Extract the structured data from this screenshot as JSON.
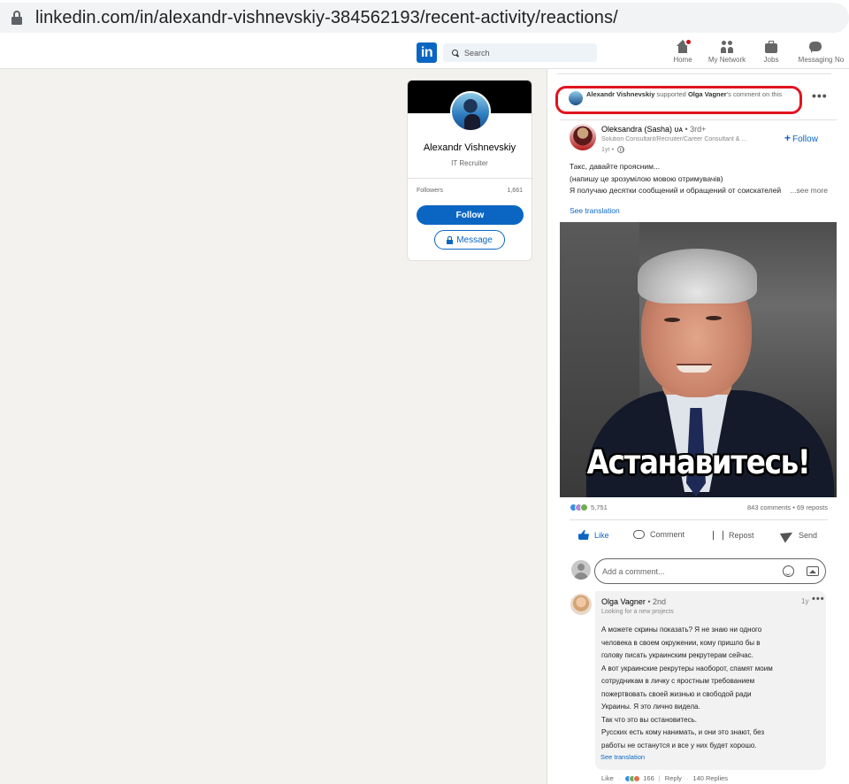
{
  "browser": {
    "url": "linkedin.com/in/alexandr-vishnevskiy-384562193/recent-activity/reactions/"
  },
  "nav": {
    "logo": "in",
    "search_placeholder": "Search",
    "items": [
      {
        "label": "Home",
        "icon": "home-icon"
      },
      {
        "label": "My Network",
        "icon": "network-icon"
      },
      {
        "label": "Jobs",
        "icon": "briefcase-icon"
      },
      {
        "label": "Messaging",
        "icon": "message-icon"
      },
      {
        "label": "No",
        "icon": "bell-icon"
      }
    ]
  },
  "profile": {
    "name": "Alexandr Vishnevskiy",
    "title": "IT Recruiter",
    "followers_label": "Followers",
    "followers_count": "1,661",
    "follow_label": "Follow",
    "message_label": "Message"
  },
  "activity": {
    "actor": "Alexandr Vishnevskiy",
    "verb": " supported ",
    "target": "Olga Vagner",
    "suffix": "'s comment on this"
  },
  "post": {
    "author": "Oleksandra (Sasha) ᴜᴀ",
    "degree": " • 3rd+",
    "headline": "Solution Consultant/Recruiter/Career Consultant & ...",
    "time": "1yr •",
    "follow_label": "Follow",
    "text_lines": [
      "Такс, давайте проясним...",
      "(напишу це зрозумілою мовою отримувачів)",
      "Я получаю десятки сообщений и обращений от соискателей"
    ],
    "see_more": "...see more",
    "see_translation": "See translation",
    "image_caption": "Астанавитесь!",
    "reactions_count": "5,751",
    "comments_reposts": "843 comments • 69 reposts",
    "actions": {
      "like": "Like",
      "comment": "Comment",
      "repost": "Repost",
      "send": "Send"
    },
    "comment_placeholder": "Add a comment..."
  },
  "comment": {
    "author": "Olga Vagner",
    "degree": " • 2nd",
    "headline": "Looking for a new projects",
    "time": "1y",
    "lines": [
      "А можете скрины показать? Я не знаю ни одного",
      "человека в своем окружении, кому пришло бы в",
      "голову писать украинским рекрутерам сейчас.",
      "А вот украинские рекрутеры наоборот, спамят моим",
      "сотрудникам в личку с яростным требованием",
      "пожертвовать своей жизнью и свободой ради",
      "Украины. Я это лично видела.",
      "Так что это вы остановитесь.",
      "Русских есть кому нанимать, и они это знают, без",
      "работы не останутся и все у них будет хорошо."
    ],
    "see_translation": "See translation",
    "like_label": "Like",
    "reactions_count": "166",
    "reply_label": "Reply",
    "replies": "140 Replies"
  },
  "colors": {
    "brand": "#0a66c2",
    "highlight": "#e0141e",
    "background": "#f3f2ef"
  }
}
